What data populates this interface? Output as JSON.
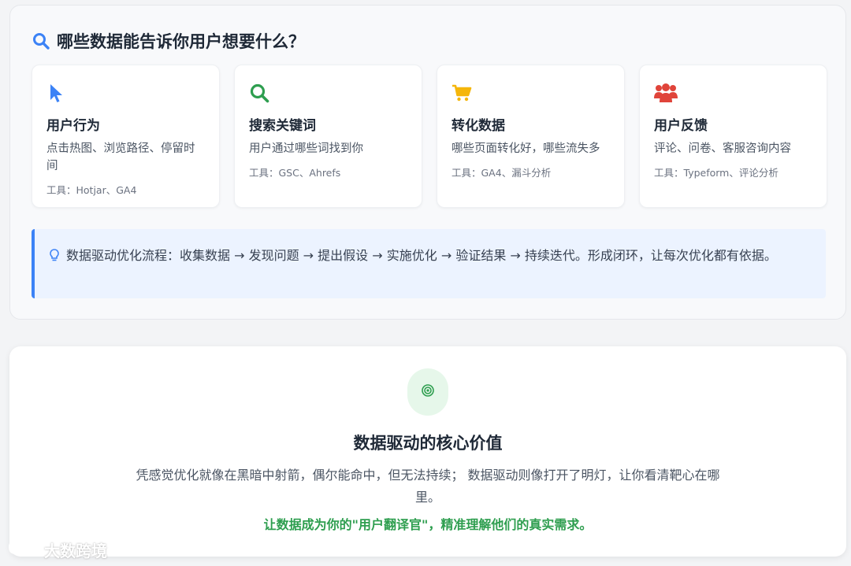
{
  "data_section": {
    "title": "哪些数据能告诉你用户想要什么？",
    "title_icon": "search-icon",
    "cards": [
      {
        "icon": "cursor-pointer-icon",
        "icon_color": "#3b82f6",
        "title": "用户行为",
        "desc": "点击热图、浏览路径、停留时间",
        "tools": "工具：Hotjar、GA4"
      },
      {
        "icon": "search-icon",
        "icon_color": "#2e9e4f",
        "title": "搜索关键词",
        "desc": "用户通过哪些词找到你",
        "tools": "工具：GSC、Ahrefs"
      },
      {
        "icon": "shopping-cart-icon",
        "icon_color": "#f5b60a",
        "title": "转化数据",
        "desc": "哪些页面转化好，哪些流失多",
        "tools": "工具：GA4、漏斗分析"
      },
      {
        "icon": "users-icon",
        "icon_color": "#e0443a",
        "title": "用户反馈",
        "desc": "评论、问卷、客服咨询内容",
        "tools": "工具：Typeform、评论分析"
      }
    ],
    "tip": {
      "icon": "lightbulb-icon",
      "text": "数据驱动优化流程：收集数据 → 发现问题 → 提出假设 → 实施优化 → 验证结果 → 持续迭代。形成闭环，让每次优化都有依据。"
    }
  },
  "core_section": {
    "icon": "target-icon",
    "title": "数据驱动的核心价值",
    "text": "凭感觉优化就像在黑暗中射箭，偶尔能命中，但无法持续； 数据驱动则像打开了明灯，让你看清靶心在哪里。",
    "highlight": "让数据成为你的\"用户翻译官\"，精准理解他们的真实需求。"
  },
  "watermark": {
    "text": "大数跨境"
  },
  "colors": {
    "accent_blue": "#3b82f6",
    "accent_green": "#2e9e4f",
    "tip_bg": "#ecf3ff"
  }
}
